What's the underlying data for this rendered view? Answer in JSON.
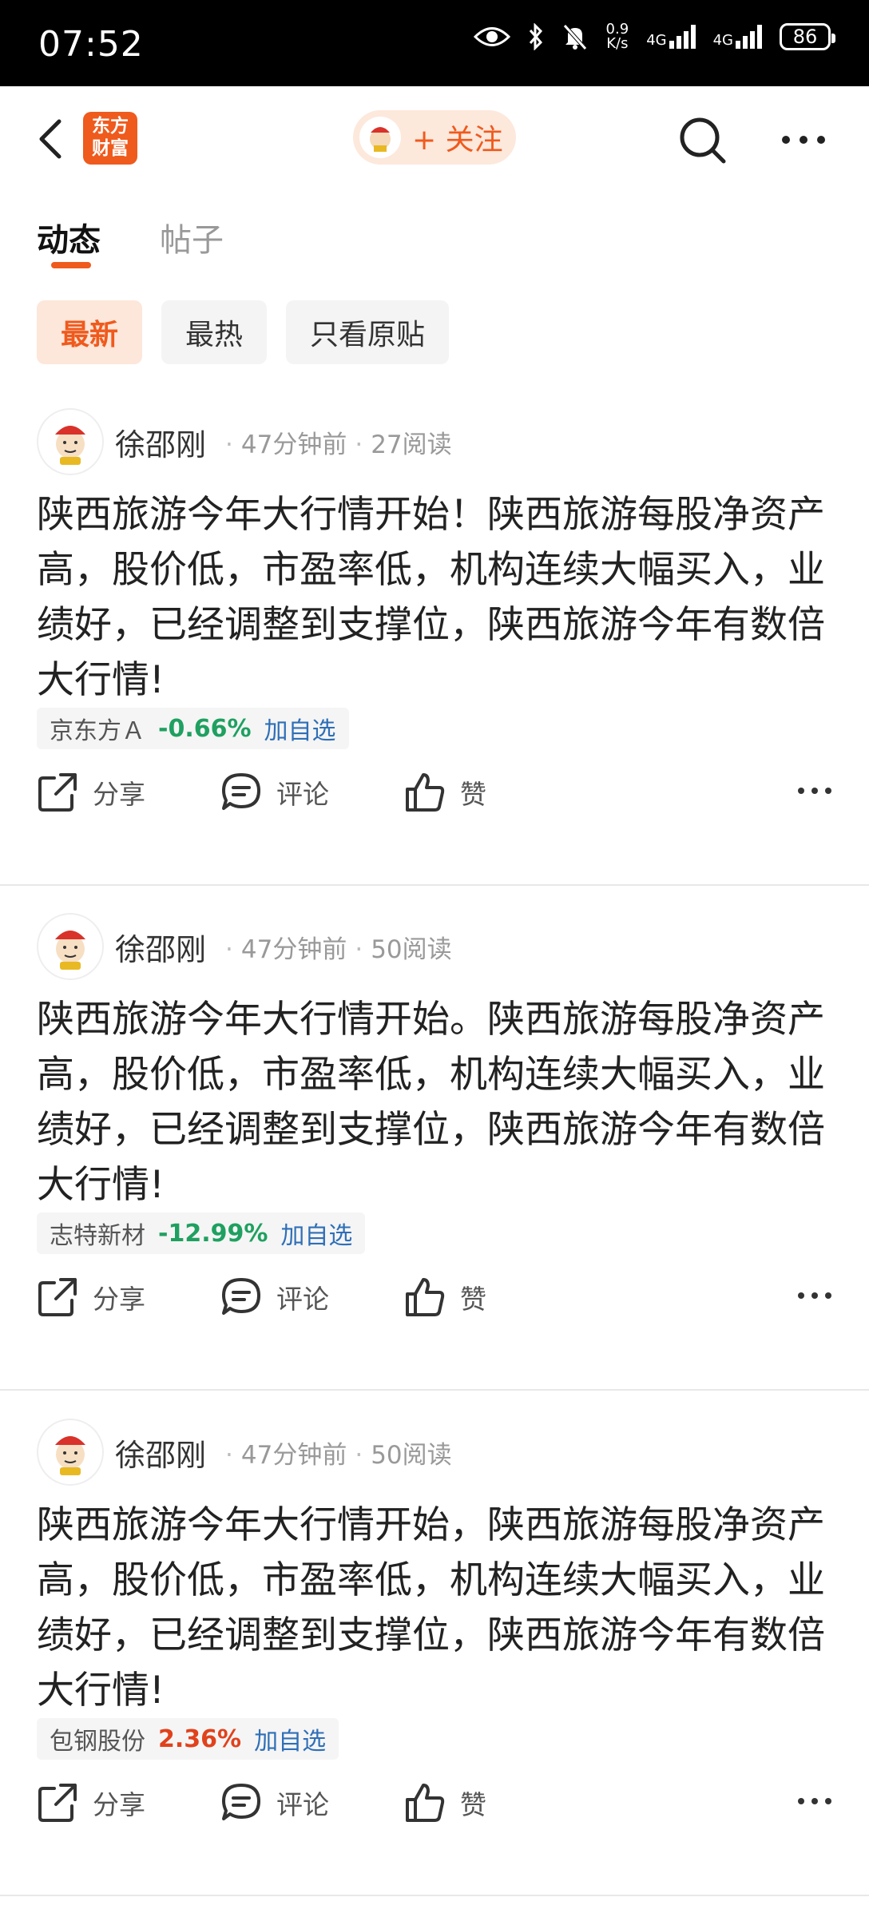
{
  "status_bar": {
    "time": "07:52",
    "net_speed": "0.9",
    "net_speed_unit": "K/s",
    "sim1": "4G",
    "sim2": "4G",
    "battery": "86"
  },
  "nav": {
    "logo_line1": "东方",
    "logo_line2": "财富",
    "follow_label": "+ 关注"
  },
  "tabs": {
    "dynamic": "动态",
    "posts": "帖子"
  },
  "filters": {
    "newest": "最新",
    "hottest": "最热",
    "original_only": "只看原贴"
  },
  "posts": [
    {
      "author": "徐邵刚",
      "time": "47分钟前",
      "reads": "27阅读",
      "text": "陕西旅游今年大行情开始！陕西旅游每股净资产高，股价低，市盈率低，机构连续大幅买入，业绩好，已经调整到支撑位，陕西旅游今年有数倍大行情!",
      "stock_name": "京东方Ａ",
      "stock_change": "-0.66%",
      "stock_color": "#1fa060",
      "add_watch": "加自选",
      "share": "分享",
      "comment": "评论",
      "like": "赞"
    },
    {
      "author": "徐邵刚",
      "time": "47分钟前",
      "reads": "50阅读",
      "text": "陕西旅游今年大行情开始。陕西旅游每股净资产高，股价低，市盈率低，机构连续大幅买入，业绩好，已经调整到支撑位，陕西旅游今年有数倍大行情!",
      "stock_name": "志特新材",
      "stock_change": "-12.99%",
      "stock_color": "#1fa060",
      "add_watch": "加自选",
      "share": "分享",
      "comment": "评论",
      "like": "赞"
    },
    {
      "author": "徐邵刚",
      "time": "47分钟前",
      "reads": "50阅读",
      "text": "陕西旅游今年大行情开始，陕西旅游每股净资产高，股价低，市盈率低，机构连续大幅买入，业绩好，已经调整到支撑位，陕西旅游今年有数倍大行情!",
      "stock_name": "包钢股份",
      "stock_change": "2.36%",
      "stock_color": "#e0421c",
      "add_watch": "加自选",
      "share": "分享",
      "comment": "评论",
      "like": "赞"
    }
  ],
  "colors": {
    "accent": "#ef5a1d",
    "link": "#2f6fb7"
  }
}
